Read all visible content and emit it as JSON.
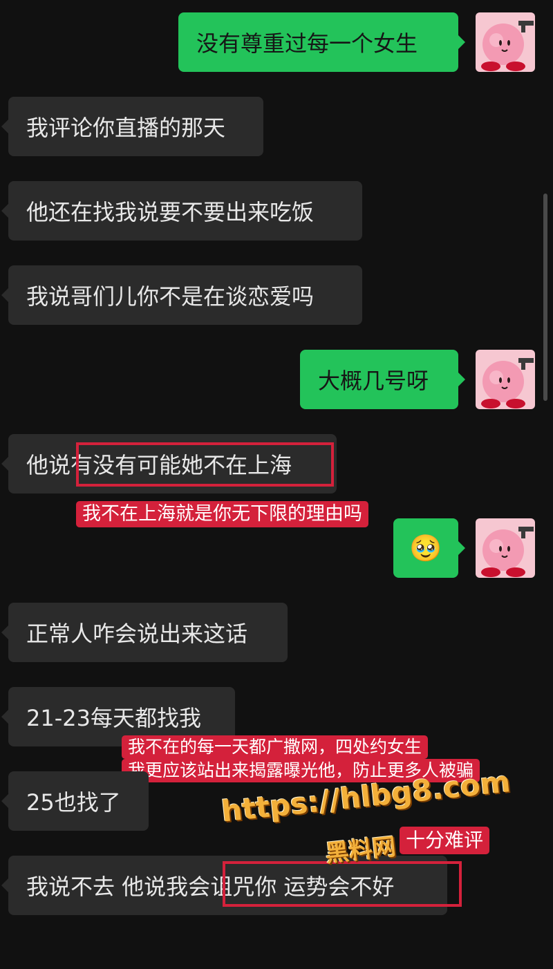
{
  "messages": [
    {
      "side": "right",
      "text": "没有尊重过每一个女生"
    },
    {
      "side": "left",
      "text": "我评论你直播的那天"
    },
    {
      "side": "left",
      "text": "他还在找我说要不要出来吃饭"
    },
    {
      "side": "left",
      "text": "我说哥们儿你不是在谈恋爱吗"
    },
    {
      "side": "right",
      "text": "大概几号呀"
    },
    {
      "side": "left",
      "text_a": "他说",
      "text_b": "有没有可能她不在上海"
    },
    {
      "side": "right",
      "emoji": "🥹",
      "emoji_name": "pleading-face-emoji"
    },
    {
      "side": "left",
      "text": "正常人咋会说出来这话"
    },
    {
      "side": "left",
      "text": "21-23每天都找我"
    },
    {
      "side": "left",
      "text": "25也找了"
    },
    {
      "side": "left",
      "text_a": "我说不去 他说我会",
      "text_b": "诅咒你 运势会不好"
    }
  ],
  "annotations": {
    "note1": "我不在上海就是你无下限的理由吗",
    "note2_line1": "我不在的每一天都广撒网，四处约女生",
    "note2_line2": "我更应该站出来揭露曝光他，防止更多人被骗",
    "note3": "十分难评"
  },
  "watermark": {
    "url": "https://hlbg8.com",
    "site": "黑料网"
  },
  "avatar": {
    "icon": "pink-plush-with-gun-avatar"
  },
  "colors": {
    "background": "#111111",
    "incoming_bubble": "#2b2b2b",
    "outgoing_bubble": "#23c35a",
    "highlight": "#d4213b",
    "watermark": "#f3b03a"
  }
}
